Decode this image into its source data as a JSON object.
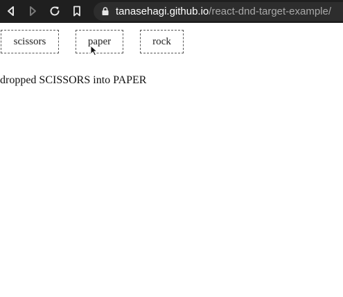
{
  "browser": {
    "url_host": "tanasehagi.github.io",
    "url_path": "/react-dnd-target-example/",
    "icons": [
      "back-icon",
      "forward-icon",
      "reload-icon",
      "bookmark-icon",
      "lock-icon"
    ]
  },
  "boxes": [
    {
      "label": "scissors"
    },
    {
      "label": "paper"
    },
    {
      "label": "rock"
    }
  ],
  "status": {
    "message": "dropped SCISSORS into PAPER"
  },
  "colors": {
    "chrome_bg": "#1f1f1f",
    "url_bar_bg": "#2d2d2d",
    "box_border": "#555555"
  }
}
